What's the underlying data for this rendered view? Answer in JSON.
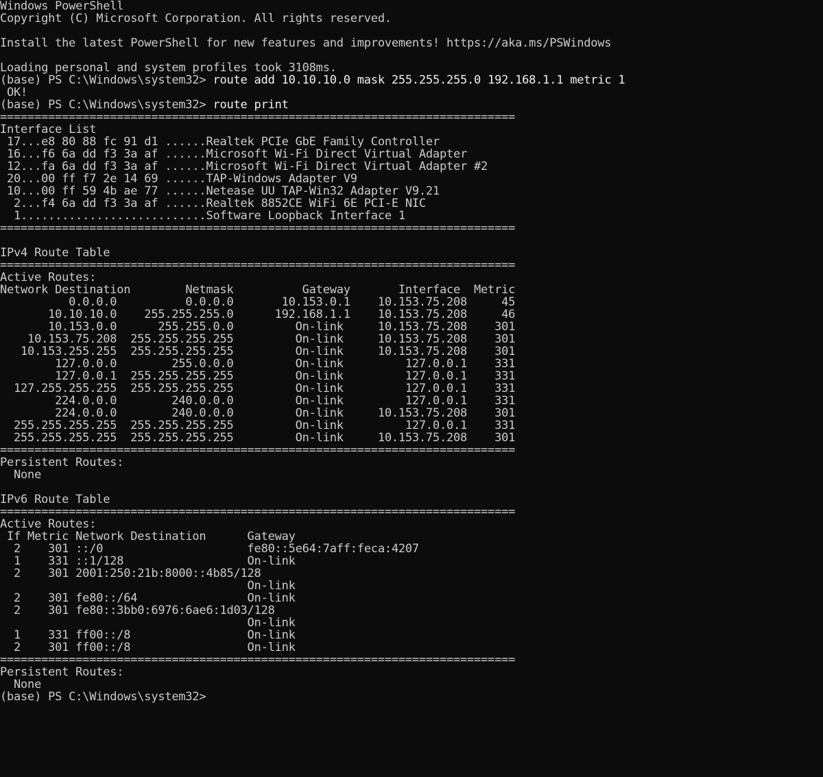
{
  "terminal": {
    "lines": [
      {
        "text": "Windows PowerShell"
      },
      {
        "text": "Copyright (C) Microsoft Corporation. All rights reserved."
      },
      {
        "text": ""
      },
      {
        "text": "Install the latest PowerShell for new features and improvements! https://aka.ms/PSWindows"
      },
      {
        "text": ""
      },
      {
        "text": "Loading personal and system profiles took 3108ms."
      },
      {
        "prompt": "(base) PS C:\\Windows\\system32> ",
        "command": "route add 10.10.10.0 mask 255.255.255.0 192.168.1.1 metric 1"
      },
      {
        "text": " OK!"
      },
      {
        "prompt": "(base) PS C:\\Windows\\system32> ",
        "command": "route print"
      },
      {
        "text": "==========================================================================="
      },
      {
        "text": "Interface List"
      },
      {
        "text": " 17...e8 80 88 fc 91 d1 ......Realtek PCIe GbE Family Controller"
      },
      {
        "text": " 16...f6 6a dd f3 3a af ......Microsoft Wi-Fi Direct Virtual Adapter"
      },
      {
        "text": " 12...fa 6a dd f3 3a af ......Microsoft Wi-Fi Direct Virtual Adapter #2"
      },
      {
        "text": " 20...00 ff f7 2e 14 69 ......TAP-Windows Adapter V9"
      },
      {
        "text": " 10...00 ff 59 4b ae 77 ......Netease UU TAP-Win32 Adapter V9.21"
      },
      {
        "text": "  2...f4 6a dd f3 3a af ......Realtek 8852CE WiFi 6E PCI-E NIC"
      },
      {
        "text": "  1...........................Software Loopback Interface 1"
      },
      {
        "text": "==========================================================================="
      },
      {
        "text": ""
      },
      {
        "text": "IPv4 Route Table"
      },
      {
        "text": "==========================================================================="
      },
      {
        "text": "Active Routes:"
      },
      {
        "text": "Network Destination        Netmask          Gateway       Interface  Metric"
      },
      {
        "text": "          0.0.0.0          0.0.0.0       10.153.0.1    10.153.75.208     45"
      },
      {
        "text": "       10.10.10.0    255.255.255.0      192.168.1.1    10.153.75.208     46"
      },
      {
        "text": "       10.153.0.0      255.255.0.0         On-link     10.153.75.208    301"
      },
      {
        "text": "    10.153.75.208  255.255.255.255         On-link     10.153.75.208    301"
      },
      {
        "text": "   10.153.255.255  255.255.255.255         On-link     10.153.75.208    301"
      },
      {
        "text": "        127.0.0.0        255.0.0.0         On-link         127.0.0.1    331"
      },
      {
        "text": "        127.0.0.1  255.255.255.255         On-link         127.0.0.1    331"
      },
      {
        "text": "  127.255.255.255  255.255.255.255         On-link         127.0.0.1    331"
      },
      {
        "text": "        224.0.0.0        240.0.0.0         On-link         127.0.0.1    331"
      },
      {
        "text": "        224.0.0.0        240.0.0.0         On-link     10.153.75.208    301"
      },
      {
        "text": "  255.255.255.255  255.255.255.255         On-link         127.0.0.1    331"
      },
      {
        "text": "  255.255.255.255  255.255.255.255         On-link     10.153.75.208    301"
      },
      {
        "text": "==========================================================================="
      },
      {
        "text": "Persistent Routes:"
      },
      {
        "text": "  None"
      },
      {
        "text": ""
      },
      {
        "text": "IPv6 Route Table"
      },
      {
        "text": "==========================================================================="
      },
      {
        "text": "Active Routes:"
      },
      {
        "text": " If Metric Network Destination      Gateway"
      },
      {
        "text": "  2    301 ::/0                     fe80::5e64:7aff:feca:4207"
      },
      {
        "text": "  1    331 ::1/128                  On-link"
      },
      {
        "text": "  2    301 2001:250:21b:8000::4b85/128"
      },
      {
        "text": "                                    On-link"
      },
      {
        "text": "  2    301 fe80::/64                On-link"
      },
      {
        "text": "  2    301 fe80::3bb0:6976:6ae6:1d03/128"
      },
      {
        "text": "                                    On-link"
      },
      {
        "text": "  1    331 ff00::/8                 On-link"
      },
      {
        "text": "  2    301 ff00::/8                 On-link"
      },
      {
        "text": "==========================================================================="
      },
      {
        "text": "Persistent Routes:"
      },
      {
        "text": "  None"
      },
      {
        "prompt": "(base) PS C:\\Windows\\system32>",
        "command": ""
      }
    ]
  }
}
